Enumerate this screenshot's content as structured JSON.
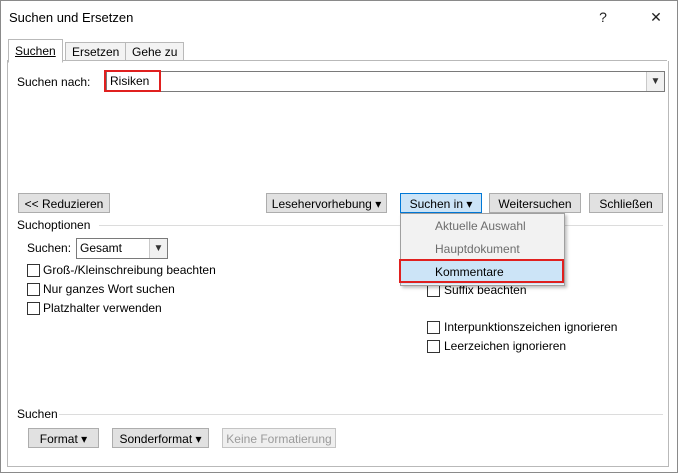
{
  "window": {
    "title": "Suchen und Ersetzen",
    "help_icon": "?",
    "close_icon": "✕"
  },
  "tabs": [
    {
      "label": "Suchen",
      "active": true
    },
    {
      "label": "Ersetzen",
      "active": false
    },
    {
      "label": "Gehe zu",
      "active": false
    }
  ],
  "search": {
    "label": "Suchen nach:",
    "value": "Risiken"
  },
  "buttons": {
    "reduce": "<< Reduzieren",
    "reading_highlight": "Lesehervorhebung",
    "search_in": "Suchen in",
    "find_next": "Weitersuchen",
    "close": "Schließen"
  },
  "search_in_menu": {
    "items": [
      "Aktuelle Auswahl",
      "Hauptdokument",
      "Kommentare"
    ],
    "selected": "Kommentare"
  },
  "options": {
    "group_title": "Suchoptionen",
    "direction_label": "Suchen:",
    "direction_value": "Gesamt",
    "left": [
      "Groß-/Kleinschreibung beachten",
      "Nur ganzes Wort suchen",
      "Platzhalter verwenden"
    ],
    "right": [
      "Suffix beachten",
      "Interpunktionszeichen ignorieren",
      "Leerzeichen ignorieren"
    ]
  },
  "format_section": {
    "title": "Suchen",
    "format_button": "Format",
    "special_button": "Sonderformat",
    "no_format_button": "Keine Formatierung"
  },
  "colors": {
    "highlight_border": "#e0201f",
    "menu_selected_bg": "#cce4f7"
  }
}
